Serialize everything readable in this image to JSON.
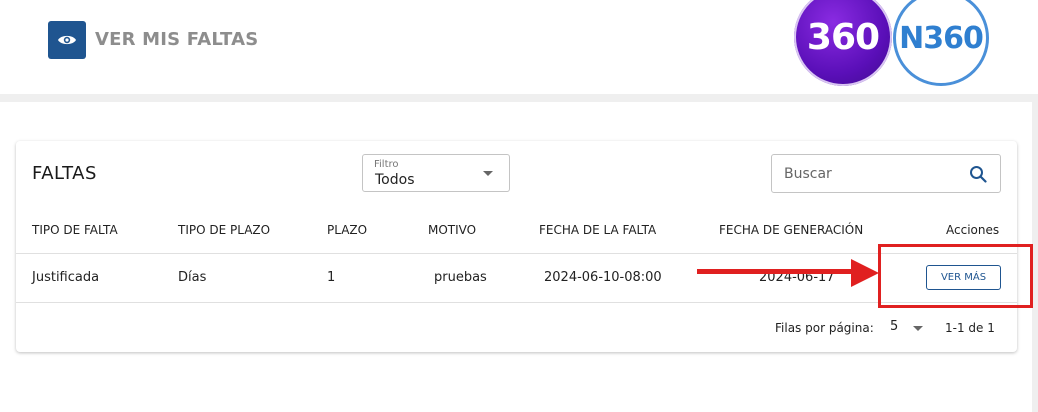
{
  "header": {
    "title": "VER MIS FALTAS",
    "title_icon": "eye-icon",
    "logos": [
      "360",
      "N360"
    ]
  },
  "card": {
    "title": "FALTAS",
    "filter": {
      "label": "Filtro",
      "value": "Todos"
    },
    "search": {
      "placeholder": "Buscar",
      "icon": "search-icon"
    },
    "columns": [
      "TIPO DE FALTA",
      "TIPO DE PLAZO",
      "PLAZO",
      "MOTIVO",
      "FECHA DE LA FALTA",
      "FECHA DE GENERACIÓN",
      "Acciones"
    ],
    "rows": [
      {
        "tipo_falta": "Justificada",
        "tipo_plazo": "Días",
        "plazo": "1",
        "motivo": "pruebas",
        "fecha_falta": "2024-06-10-08:00",
        "fecha_generacion": "2024-06-17",
        "action_label": "VER MÁS"
      }
    ],
    "pagination": {
      "rows_per_page_label": "Filas por página:",
      "rows_per_page": "5",
      "range": "1-1 de 1"
    }
  },
  "colors": {
    "primary": "#1f5590",
    "annotation": "#e02020",
    "logo_purple": "#6a1bc9",
    "logo_blue": "#2f7fd0"
  }
}
